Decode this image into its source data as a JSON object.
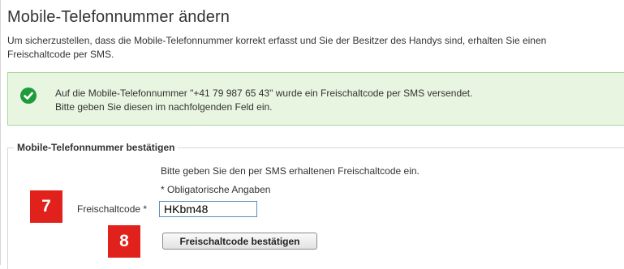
{
  "page": {
    "title": "Mobile-Telefonnummer ändern",
    "intro": "Um sicherzustellen, dass die Mobile-Telefonnummer korrekt erfasst und Sie der Besitzer des Handys sind, erhalten Sie einen Freischaltcode per SMS."
  },
  "success_message": {
    "icon": "checkmark-circle-icon",
    "color": "#1e9b3b",
    "line1": "Auf die Mobile-Telefonnummer \"+41 79 987 65 43\" wurde ein Freischaltcode per SMS versendet.",
    "line2": "Bitte geben Sie diesen im nachfolgenden Feld ein."
  },
  "confirm_section": {
    "legend": "Mobile-Telefonnummer bestätigen",
    "hint": "Bitte geben Sie den per SMS erhaltenen Freischaltcode ein.",
    "required_note": "* Obligatorische Angaben",
    "code_label": "Freischaltcode *",
    "code_value": "HKbm48",
    "confirm_button_label": "Freischaltcode bestätigen"
  },
  "annotations": {
    "badge_color": "#e1211b",
    "step_7": "7",
    "step_8": "8"
  }
}
